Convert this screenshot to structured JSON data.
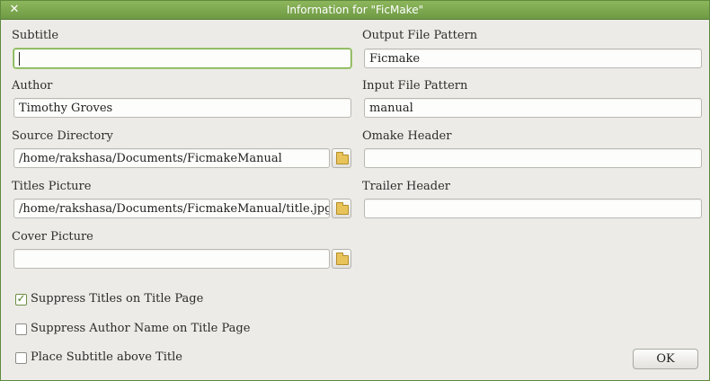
{
  "window": {
    "title": "Information for \"FicMake\"",
    "close_glyph": "✕"
  },
  "form": {
    "subtitle": {
      "label": "Subtitle",
      "value": ""
    },
    "output_file_pattern": {
      "label": "Output File Pattern",
      "value": "Ficmake"
    },
    "author": {
      "label": "Author",
      "value": "Timothy Groves"
    },
    "input_file_pattern": {
      "label": "Input File Pattern",
      "value": "manual"
    },
    "source_directory": {
      "label": "Source Directory",
      "value": "/home/rakshasa/Documents/FicmakeManual"
    },
    "omake_header": {
      "label": "Omake Header",
      "value": ""
    },
    "titles_picture": {
      "label": "Titles Picture",
      "value": "/home/rakshasa/Documents/FicmakeManual/title.jpg"
    },
    "trailer_header": {
      "label": "Trailer Header",
      "value": ""
    },
    "cover_picture": {
      "label": "Cover Picture",
      "value": ""
    }
  },
  "options": [
    {
      "label": "Suppress Titles on Title Page",
      "checked": true
    },
    {
      "label": "Suppress Author Name on Title Page",
      "checked": false
    },
    {
      "label": "Place Subtitle above Title",
      "checked": false
    }
  ],
  "buttons": {
    "ok": "OK"
  },
  "icons": {
    "browse": "folder-icon",
    "close": "close-icon"
  },
  "colors": {
    "titlebar": "#7aa64d",
    "focus_ring": "#7fae4e",
    "checkmark": "#4f7f27"
  }
}
